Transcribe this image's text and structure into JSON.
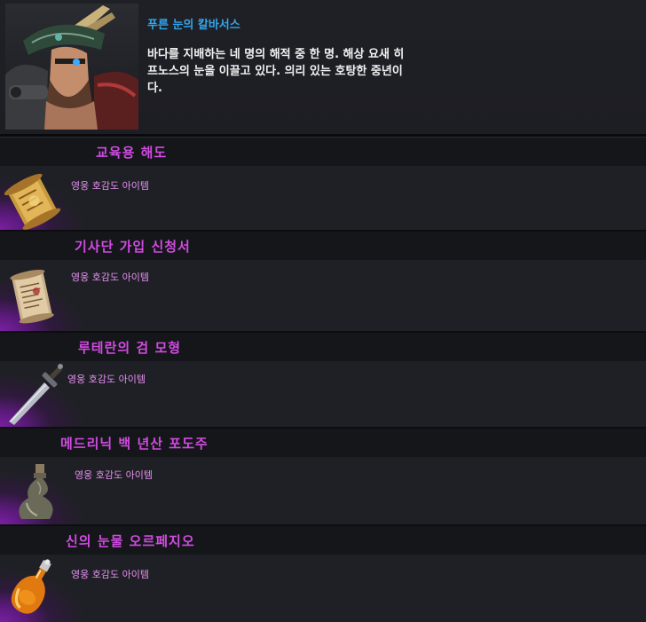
{
  "npc": {
    "name": "푸른 눈의 칼바서스",
    "description": "바다를 지배하는 네 명의 해적 중 한 명. 해상 요새 히프노스의 눈을 이끌고 있다. 의리 있는 호탕한 중년이다."
  },
  "items": [
    {
      "title": "교육용 해도",
      "desc": "영웅 호감도 아이템",
      "icon": "sea-chart-scroll-icon"
    },
    {
      "title": "기사단 가입 신청서",
      "desc": "영웅 호감도 아이템",
      "icon": "application-scroll-icon"
    },
    {
      "title": "루테란의 검 모형",
      "desc": "영웅 호감도 아이템",
      "icon": "sword-model-icon"
    },
    {
      "title": "메드리닉 백 년산 포도주",
      "desc": "영웅 호감도 아이템",
      "icon": "wine-bottle-icon"
    },
    {
      "title": "신의 눈물 오르페지오",
      "desc": "영웅 호감도 아이템",
      "icon": "potion-flask-icon"
    }
  ],
  "colors": {
    "npc_name": "#33a6ec",
    "item_title": "#d14be3",
    "item_desc": "#e48ff0",
    "rarity_glow": "#7a1fa2"
  }
}
